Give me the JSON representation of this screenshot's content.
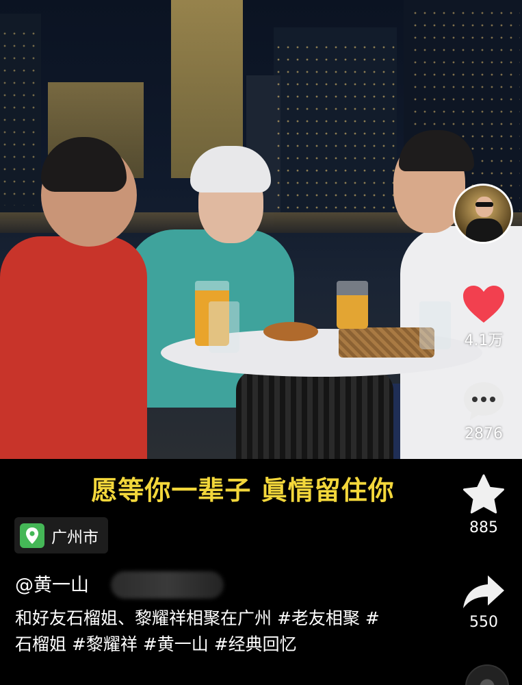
{
  "video": {
    "caption": "愿等你一辈子 眞情留住你"
  },
  "location": {
    "label": "广州市",
    "icon": "location-pin-icon"
  },
  "post": {
    "author": "@黄一山",
    "description": "和好友石榴姐、黎耀祥相聚在广州 #老友相聚 #石榴姐 #黎耀祥 #黄一山 #经典回忆"
  },
  "actions": {
    "like_count": "4.1万",
    "comment_count": "2876",
    "favorite_count": "885",
    "share_count": "550"
  },
  "colors": {
    "caption": "#f3d73b",
    "like": "#f2404f",
    "location_icon": "#45b757"
  }
}
